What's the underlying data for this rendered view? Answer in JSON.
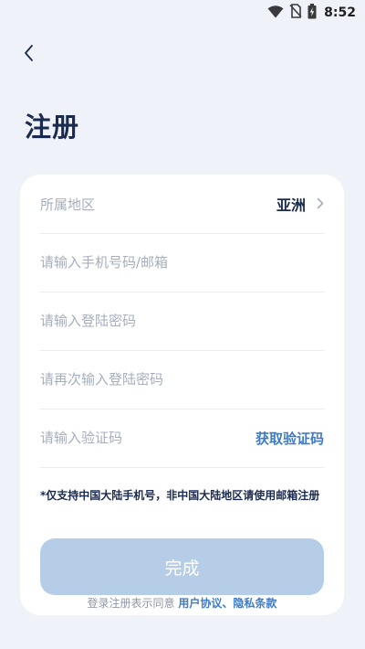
{
  "status_bar": {
    "time": "8:52",
    "icons": [
      "wifi-icon",
      "no-sim-icon",
      "battery-charging-icon"
    ]
  },
  "header": {
    "back_icon": "chevron-left-icon",
    "title": "注册"
  },
  "form": {
    "region": {
      "label": "所属地区",
      "value": "亚洲",
      "icon": "chevron-right-icon"
    },
    "phone_email": {
      "placeholder": "请输入手机号码/邮箱",
      "value": ""
    },
    "password": {
      "placeholder": "请输入登陆密码",
      "value": ""
    },
    "password_confirm": {
      "placeholder": "请再次输入登陆密码",
      "value": ""
    },
    "verification_code": {
      "placeholder": "请输入验证码",
      "value": "",
      "get_code_label": "获取验证码"
    },
    "notice": "*仅支持中国大陆手机号，非中国大陆地区请使用邮箱注册",
    "submit_label": "完成"
  },
  "agreement": {
    "prefix": "登录注册表示同意",
    "user_agreement": "用户协议",
    "separator": "、",
    "privacy_policy": "隐私条款"
  },
  "colors": {
    "background": "#eff3f9",
    "card": "#ffffff",
    "title": "#1b2b4f",
    "placeholder": "#a6aebd",
    "link": "#3f7bc6",
    "button_disabled": "#b6cde8"
  }
}
